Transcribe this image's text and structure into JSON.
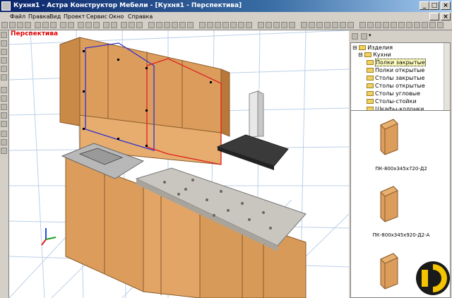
{
  "window": {
    "title": "Кухня1 - Астра Конструктор Мебели - [Кухня1 - Перспектива]"
  },
  "menu": [
    "Файл",
    "Правка",
    "Вид",
    "Проект",
    "Сервис",
    "Окно",
    "Справка"
  ],
  "viewport": {
    "label": "Перспектива"
  },
  "tree": {
    "items": [
      {
        "label": "Изделия",
        "level": 0,
        "expand": "-"
      },
      {
        "label": "Кухни",
        "level": 1,
        "expand": "-"
      },
      {
        "label": "Полки закрытые",
        "level": 2,
        "selected": true
      },
      {
        "label": "Полки открытые",
        "level": 2
      },
      {
        "label": "Столы закрытые",
        "level": 2
      },
      {
        "label": "Столы открытые",
        "level": 2
      },
      {
        "label": "Столы угловые",
        "level": 2
      },
      {
        "label": "Столы-стойки",
        "level": 2
      },
      {
        "label": "Шкафы-колонки",
        "level": 2
      }
    ]
  },
  "gallery": {
    "items": [
      {
        "caption": "ПК-800х345х720-Д2"
      },
      {
        "caption": "ПК-800х345х920-Д2-А"
      },
      {
        "caption": ""
      }
    ]
  },
  "colors": {
    "title_start": "#0a246a",
    "title_end": "#a6caf0",
    "wood": "#e0a060",
    "viewport_label": "#e00000"
  }
}
